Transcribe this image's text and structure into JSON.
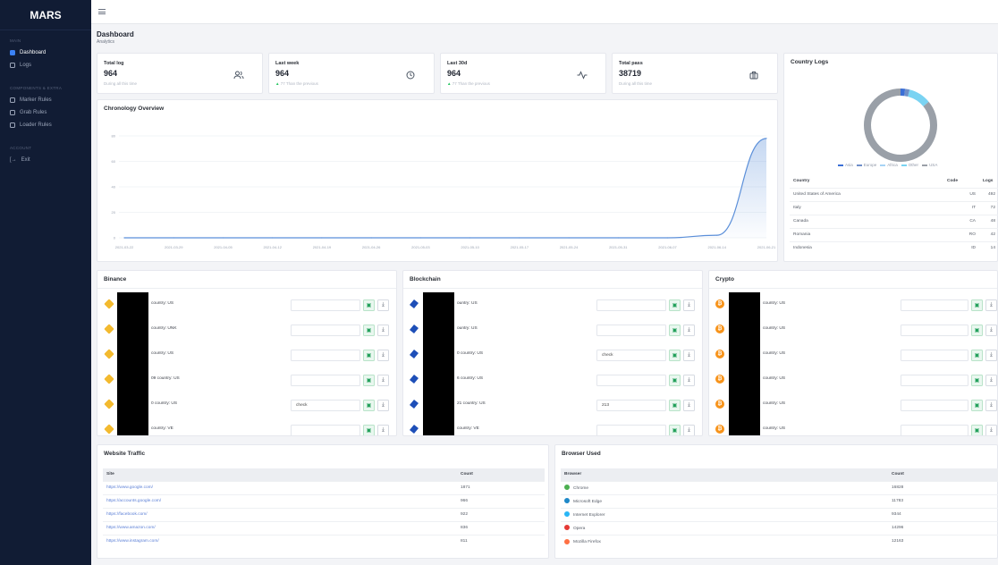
{
  "sidebar": {
    "brand": "MARS",
    "section_main": "MAIN",
    "section_components": "COMPONENTS & EXTRA",
    "section_account": "ACCOUNT",
    "items_main": [
      {
        "label": "Dashboard",
        "icon": "grid-icon"
      },
      {
        "label": "Logs",
        "icon": "list-icon"
      }
    ],
    "items_components": [
      {
        "label": "Marker Rules",
        "icon": "edit-icon"
      },
      {
        "label": "Grab Rules",
        "icon": "grab-icon"
      },
      {
        "label": "Loader Rules",
        "icon": "loader-icon"
      }
    ],
    "items_account": [
      {
        "label": "Exit",
        "icon": "exit-icon"
      }
    ]
  },
  "header": {
    "title": "Dashboard",
    "subtitle": "Analytics"
  },
  "stats": [
    {
      "label": "Total log",
      "value": "964",
      "sub": "During all this time",
      "sub_up": "",
      "icon": "users-icon"
    },
    {
      "label": "Last week",
      "value": "964",
      "sub": " 77 Than the previous",
      "sub_up": "▲",
      "icon": "clock-icon"
    },
    {
      "label": "Last 30d",
      "value": "964",
      "sub": " 77 Than the previous",
      "sub_up": "▲",
      "icon": "activity-icon"
    },
    {
      "label": "Total pass",
      "value": "38719",
      "sub": "During all this time",
      "sub_up": "",
      "icon": "briefcase-icon"
    }
  ],
  "chronology": {
    "title": "Chronology Overview",
    "chart_data": {
      "type": "area",
      "title": "Chronology Overview",
      "x": [
        "2021-03-22",
        "2021-03-29",
        "2021-04-05",
        "2021-04-12",
        "2021-04-19",
        "2021-04-26",
        "2021-05-03",
        "2021-05-10",
        "2021-05-17",
        "2021-05-24",
        "2021-05-31",
        "2021-06-07",
        "2021-06-14",
        "2021-06-21"
      ],
      "y": [
        0,
        0,
        0,
        0,
        0,
        0,
        0,
        0,
        0,
        0,
        0,
        0,
        2,
        78
      ],
      "ylim": [
        0,
        80
      ],
      "yticks": [
        0,
        20,
        40,
        60,
        80
      ],
      "color": "#5b8fd9",
      "grid": true
    }
  },
  "country_logs": {
    "title": "Country Logs",
    "donut": [
      {
        "name": "Asia",
        "value": 2,
        "color": "#3b6fd6"
      },
      {
        "name": "Europe",
        "value": 2,
        "color": "#6f8fc9"
      },
      {
        "name": "Africa",
        "value": 0,
        "color": "#a7d3f5"
      },
      {
        "name": "Other",
        "value": 10,
        "color": "#7ad3f2"
      },
      {
        "name": "USA",
        "value": 86,
        "color": "#9aa0a8"
      }
    ],
    "columns": [
      "Country",
      "Code",
      "Logs"
    ],
    "rows": [
      [
        "United States of America",
        "US",
        "492"
      ],
      [
        "Italy",
        "IT",
        "72"
      ],
      [
        "Canada",
        "CA",
        "48"
      ],
      [
        "Romania",
        "RO",
        "42"
      ],
      [
        "Indonesia",
        "ID",
        "14"
      ]
    ]
  },
  "binance": {
    "title": "Binance",
    "rows": [
      {
        "info": "country: US",
        "input": ""
      },
      {
        "info": "country: UNK",
        "input": ""
      },
      {
        "info": "country: US",
        "input": ""
      },
      {
        "info": "09 country: US",
        "input": ""
      },
      {
        "info": "0 country: US",
        "input": "check"
      },
      {
        "info": "country: VE",
        "input": ""
      }
    ]
  },
  "blockchain": {
    "title": "Blockchain",
    "rows": [
      {
        "info": "ountry: US",
        "input": ""
      },
      {
        "info": "ountry: US",
        "input": ""
      },
      {
        "info": "0 country: US",
        "input": "check"
      },
      {
        "info": "6 country: US",
        "input": ""
      },
      {
        "info": "21 country: US",
        "input": "213"
      },
      {
        "info": "country: VE",
        "input": ""
      }
    ]
  },
  "crypto": {
    "title": "Crypto",
    "rows": [
      {
        "info": "country: US",
        "input": ""
      },
      {
        "info": "country: US",
        "input": ""
      },
      {
        "info": "country: US",
        "input": ""
      },
      {
        "info": "country: US",
        "input": ""
      },
      {
        "info": "country: US",
        "input": ""
      },
      {
        "info": "country: US",
        "input": ""
      }
    ]
  },
  "website_traffic": {
    "title": "Website Traffic",
    "columns": [
      "Site",
      "Count"
    ],
    "rows": [
      [
        "https://www.google.com/",
        "1871"
      ],
      [
        "https://accounts.google.com/",
        "966"
      ],
      [
        "https://facebook.com/",
        "922"
      ],
      [
        "https://www.amazon.com/",
        "836"
      ],
      [
        "https://www.instagram.com/",
        "811"
      ]
    ]
  },
  "browser_used": {
    "title": "Browser Used",
    "columns": [
      "Browser",
      "Count"
    ],
    "rows": [
      {
        "name": "Chrome",
        "count": "16828",
        "color": "#4caf50"
      },
      {
        "name": "Microsoft Edge",
        "count": "11783",
        "color": "#1e88c8"
      },
      {
        "name": "Internet Explorer",
        "count": "9344",
        "color": "#29b6f6"
      },
      {
        "name": "Opera",
        "count": "14296",
        "color": "#e53935"
      },
      {
        "name": "Mozilla Firefox",
        "count": "12163",
        "color": "#ff7043"
      }
    ]
  }
}
